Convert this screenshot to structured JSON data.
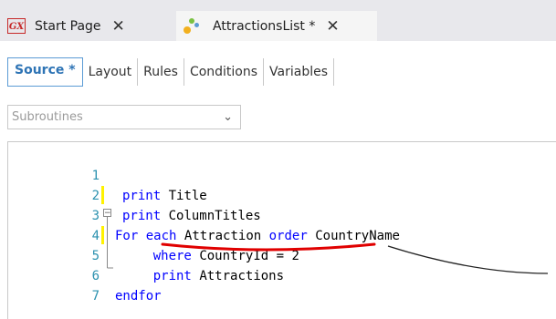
{
  "tabs": {
    "start_page": {
      "icon_text": "GX",
      "label": "Start Page"
    },
    "attractions": {
      "label": "AttractionsList *"
    }
  },
  "subtabs": [
    "Source *",
    "Layout",
    "Rules",
    "Conditions",
    "Variables"
  ],
  "subroutines": {
    "value": "Subroutines"
  },
  "code": [
    {
      "num": "1",
      "text": "print Title"
    },
    {
      "num": "2",
      "text": "print ColumnTitles"
    },
    {
      "num": "3",
      "text": "For each Attraction order CountryName"
    },
    {
      "num": "4",
      "text": "    where CountryId = 2"
    },
    {
      "num": "5",
      "text": "    print Attractions"
    },
    {
      "num": "6",
      "text": "endfor"
    },
    {
      "num": "7",
      "text": ""
    }
  ],
  "colors": {
    "underline": "#e00000",
    "keyword": "#0000ff",
    "line_number": "#2b91af",
    "active_subtab": "#2e74b5"
  }
}
